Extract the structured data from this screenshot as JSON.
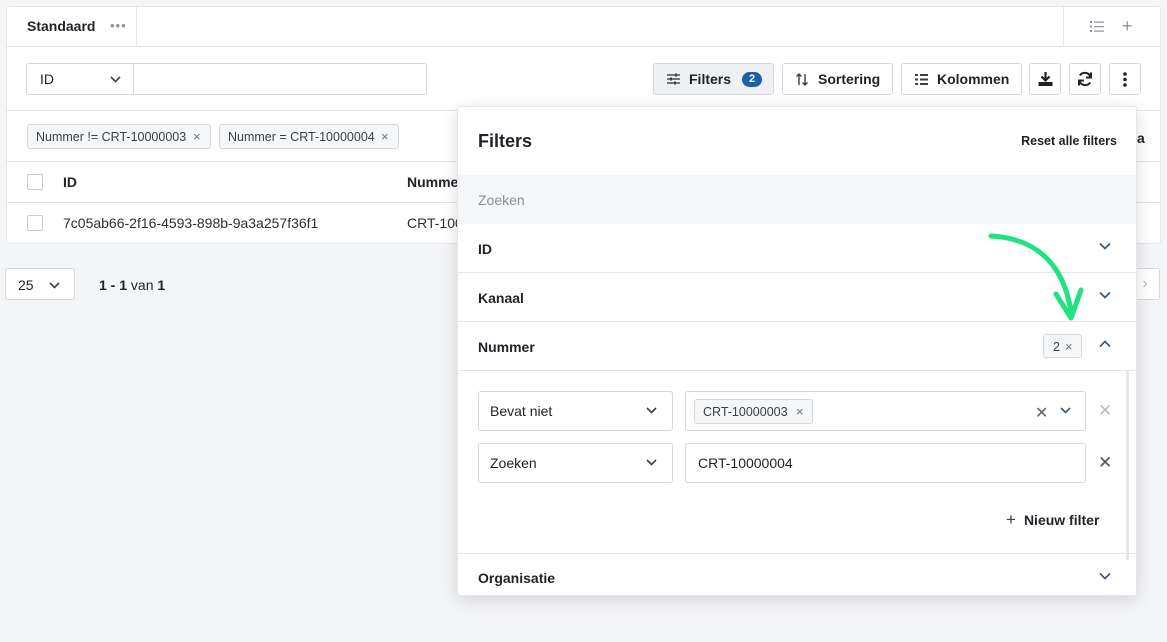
{
  "view": {
    "tab_label": "Standaard",
    "tab_more": "•••"
  },
  "toolbar": {
    "field_select": "ID",
    "search_value": "",
    "filters_label": "Filters",
    "filters_count": "2",
    "sort_label": "Sortering",
    "columns_label": "Kolommen"
  },
  "active_filters": [
    {
      "label": "Nummer != CRT-10000003"
    },
    {
      "label": "Nummer = CRT-10000004"
    }
  ],
  "table": {
    "columns": [
      "ID",
      "Nummer"
    ],
    "rows": [
      {
        "id": "7c05ab66-2f16-4593-898b-9a3a257f36f1",
        "nummer": "CRT-100"
      }
    ]
  },
  "pagination": {
    "page_size": "25",
    "range": "1 - 1",
    "of_word": "van",
    "total": "1",
    "peek_char": "a"
  },
  "filter_panel": {
    "title": "Filters",
    "reset_label": "Reset alle filters",
    "search_placeholder": "Zoeken",
    "sections": {
      "id": "ID",
      "kanaal": "Kanaal",
      "nummer": "Nummer",
      "organisatie": "Organisatie"
    },
    "nummer_count": "2",
    "rules": [
      {
        "operator": "Bevat niet",
        "value_chip": "CRT-10000003"
      },
      {
        "operator": "Zoeken",
        "value_text": "CRT-10000004"
      }
    ],
    "new_filter_label": "Nieuw filter"
  },
  "colors": {
    "accent": "#1e5fa8",
    "arrow": "#1ee37f"
  }
}
